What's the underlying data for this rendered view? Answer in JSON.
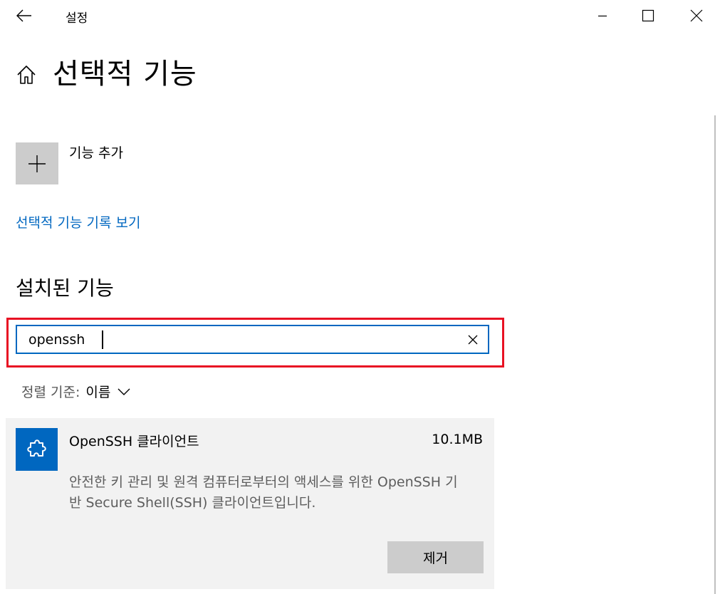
{
  "window": {
    "title": "설정"
  },
  "page": {
    "title": "선택적 기능"
  },
  "add_feature": {
    "label": "기능 추가",
    "icon": "plus-icon"
  },
  "history_link": {
    "label": "선택적 기능 기록 보기"
  },
  "installed": {
    "title": "설치된 기능",
    "search": {
      "value": "openssh"
    },
    "sort": {
      "label": "정렬 기준:",
      "value": "이름"
    },
    "features": [
      {
        "name": "OpenSSH 클라이언트",
        "size": "10.1MB",
        "description": "안전한 키 관리 및 원격 컴퓨터로부터의 액세스를 위한 OpenSSH 기반 Secure Shell(SSH) 클라이언트입니다.",
        "remove_label": "제거",
        "icon": "puzzle-icon"
      }
    ]
  },
  "colors": {
    "accent": "#0067c0",
    "highlight": "#e81123",
    "tile_gray": "#cccccc",
    "card_bg": "#f2f2f2"
  }
}
